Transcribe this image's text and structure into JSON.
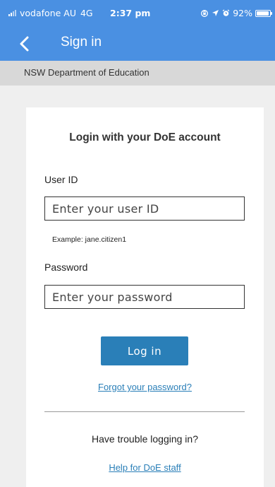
{
  "status_bar": {
    "carrier": "vodafone AU",
    "network": "4G",
    "time": "2:37 pm",
    "battery_percent": "92%",
    "battery_level": 0.92
  },
  "nav": {
    "title": "Sign in",
    "back_icon": "chevron-left-icon"
  },
  "subheader": {
    "text": "NSW Department of Education"
  },
  "login_form": {
    "title": "Login with your DoE account",
    "user_id_label": "User ID",
    "user_id_placeholder": "Enter your user ID",
    "user_id_value": "",
    "user_id_hint": "Example: jane.citizen1",
    "password_label": "Password",
    "password_placeholder": "Enter your password",
    "password_value": "",
    "login_button_label": "Log in",
    "forgot_password_link": "Forgot your password?",
    "trouble_text": "Have trouble logging in?",
    "help_link": "Help for DoE staff"
  },
  "colors": {
    "accent": "#4a90e2",
    "button": "#2a7fb8",
    "subheader_bg": "#d8d8d8",
    "page_bg": "#efefef"
  }
}
